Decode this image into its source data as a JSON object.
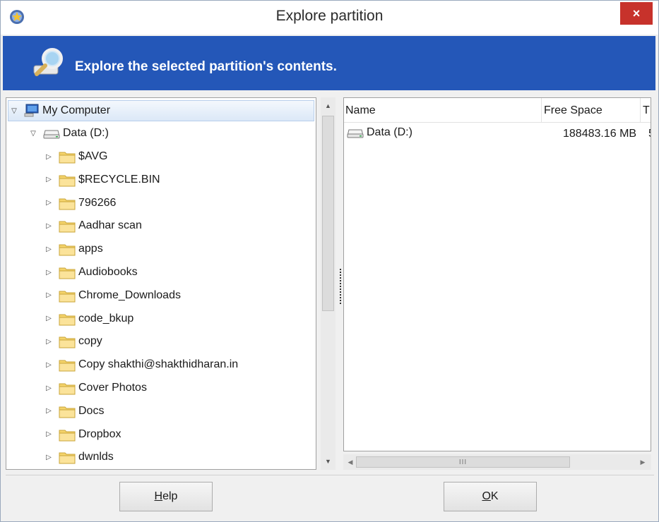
{
  "window": {
    "title": "Explore partition",
    "close_symbol": "×"
  },
  "header": {
    "text": "Explore the selected partition's contents.",
    "icon": "magnifier-drive-icon"
  },
  "tree": {
    "root_label": "My Computer",
    "drive_label": "Data (D:)",
    "folders": [
      "$AVG",
      "$RECYCLE.BIN",
      "796266",
      "Aadhar scan",
      "apps",
      "Audiobooks",
      "Chrome_Downloads",
      "code_bkup",
      "copy",
      "Copy shakthi@shakthidharan.in",
      "Cover Photos",
      "Docs",
      "Dropbox",
      "dwnlds"
    ]
  },
  "list": {
    "columns": {
      "name": "Name",
      "free_space": "Free Space",
      "type": "T"
    },
    "rows": [
      {
        "name": "Data (D:)",
        "free_space": "188483.16 MB",
        "type": "5"
      }
    ]
  },
  "hscroll": {
    "grip": "III"
  },
  "buttons": {
    "help_first": "H",
    "help_rest": "elp",
    "ok_first": "O",
    "ok_rest": "K"
  },
  "colors": {
    "header_bg": "#2457b8",
    "close_bg": "#c7322b",
    "folder": "#f5d46b"
  }
}
